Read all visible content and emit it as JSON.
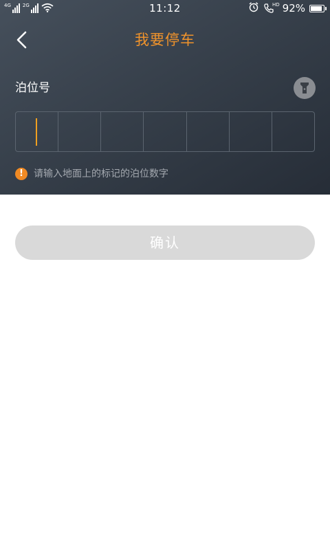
{
  "status_bar": {
    "signal_1_label": "4G",
    "signal_2_label": "2G",
    "time": "11:12",
    "hd_label": "HD",
    "battery_percent": "92%",
    "battery_level": 0.92,
    "icons": [
      "signal-icon",
      "wifi-icon",
      "alarm-icon",
      "volte-call-icon",
      "battery-icon"
    ]
  },
  "header": {
    "title": "我要停车",
    "back_icon": "chevron-left-icon"
  },
  "form": {
    "label": "泊位号",
    "flashlight_icon": "flashlight-icon",
    "digit_cells": [
      "",
      "",
      "",
      "",
      "",
      "",
      ""
    ],
    "active_cell": 0,
    "hint_icon": "!",
    "hint_text": "请输入地面上的标记的泊位数字"
  },
  "actions": {
    "confirm_label": "确认"
  },
  "colors": {
    "accent_orange": "#f0932b",
    "caret": "#f0a020",
    "hint_icon_bg": "#f08a24",
    "panel_dark": "#37404b",
    "button_disabled": "#d9d9d9"
  }
}
